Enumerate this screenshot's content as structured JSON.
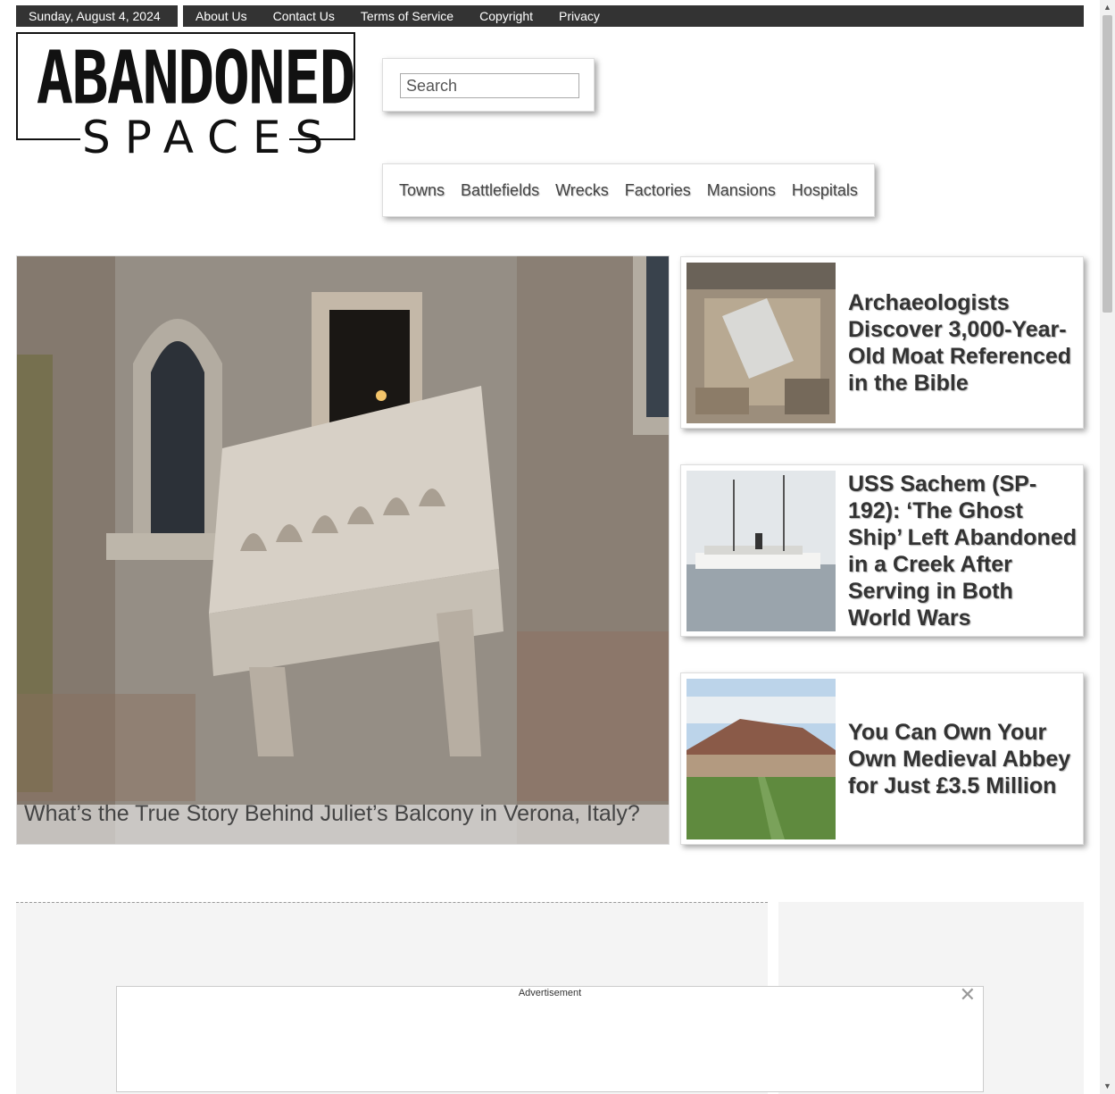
{
  "topbar": {
    "date": "Sunday, August 4, 2024",
    "links": [
      "About Us",
      "Contact Us",
      "Terms of Service",
      "Copyright",
      "Privacy"
    ]
  },
  "logo": {
    "line1": "ABANDONED",
    "line2": "SPACES"
  },
  "search": {
    "placeholder": "Search"
  },
  "nav": [
    "Towns",
    "Battlefields",
    "Wrecks",
    "Factories",
    "Mansions",
    "Hospitals"
  ],
  "hero": {
    "caption": "What’s the True Story Behind Juliet’s Balcony in Verona, Italy?"
  },
  "cards": [
    {
      "title": "Archaeologists Discover 3,000-Year-Old Moat Referenced in the Bible"
    },
    {
      "title": "USS Sachem (SP-192): ‘The Ghost Ship’ Left Abandoned in a Creek After Serving in Both World Wars"
    },
    {
      "title": "You Can Own Your Own Medieval Abbey for Just £3.5 Million"
    }
  ],
  "ad": {
    "label": "Advertisement",
    "close": "✕"
  },
  "scrollbar": {
    "up": "▲",
    "down": "▼"
  }
}
